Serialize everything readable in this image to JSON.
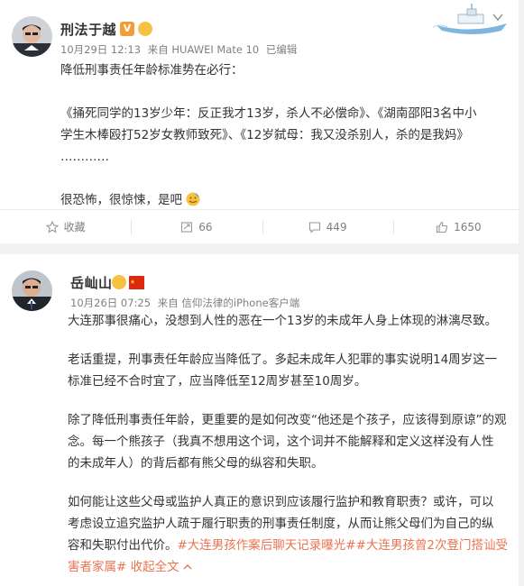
{
  "post1": {
    "author": "刑法于越",
    "date": "10月29日 12:13",
    "source_prefix": "来自",
    "device": "HUAWEI Mate 10",
    "edited": "已编辑",
    "text": {
      "line1": "降低刑事责任年龄标准势在必行：",
      "line2": "《捅死同学的13岁少年：反正我才13岁，杀人不必偿命》、《湖南邵阳3名中小",
      "line3": "学生木棒殴打52岁女教师致死》、《12岁弑母：我又没杀别人，杀的是我妈》",
      "line4": "…………",
      "line5": "很恐怖，很惊悚，是吧"
    },
    "footer": {
      "favorite_label": "收藏",
      "repost_count": "66",
      "comment_count": "449",
      "like_count": "1650"
    }
  },
  "post2": {
    "author": "岳屾山",
    "date": "10月26日 07:25",
    "source_prefix": "来自",
    "device": "信仰法律的iPhone客户端",
    "text": {
      "p1": "大连那事很痛心，没想到人性的恶在一个13岁的未成年人身上体现的淋漓尽致。",
      "p2a": "老话重提，刑事责任年龄应当降低了。多起未成年人犯罪的事实说明14周岁这一",
      "p2b": "标准已经不合时宜了，应当降低至12周岁甚至10周岁。",
      "p3a": "除了降低刑事责任年龄，更重要的是如何改变“他还是个孩子，应该得到原谅”的观",
      "p3b": "念。每一个熊孩子（我真不想用这个词，这个词并不能解释和定义这样没有人性",
      "p3c": "的未成年人）的背后都有熊父母的纵容和失职。",
      "p4a": "如何能让这些父母或监护人真正的意识到应该履行监护和教育职责？或许，可以",
      "p4b": "考虑设立追究监护人疏于履行职责的刑事责任制度，从而让熊父母们为自己的纵",
      "p4c": "容和失职付出代价。",
      "hashtag1": "#大连男孩作案后聊天记录曝光#",
      "hashtag2a": "#大连男孩曾2次登门搭讪受",
      "hashtag2b": "害者家属#",
      "collapse": "收起全文"
    }
  },
  "colors": {
    "link": "#eb7350",
    "meta": "#808080",
    "text": "#333333",
    "vip_badge": "#f29d3a"
  }
}
